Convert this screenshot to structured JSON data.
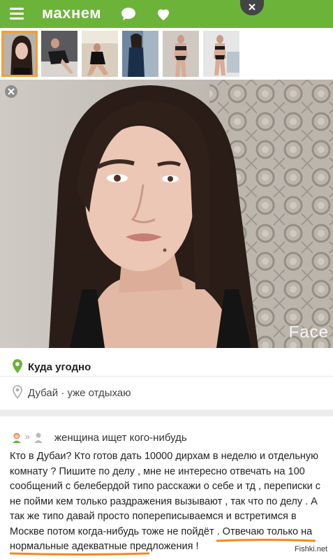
{
  "app": {
    "brand": "махнем",
    "colors": {
      "accent": "#6cb33a",
      "highlight": "#f0a030",
      "underline": "#f08a1e"
    }
  },
  "topbar": {
    "icons": [
      "menu-icon",
      "chat-bubble-icon",
      "heart-icon",
      "close-icon"
    ]
  },
  "gallery": {
    "thumbnail_count": 6,
    "selected_index": 0
  },
  "photo": {
    "watermark": "Face"
  },
  "locations": {
    "primary": "Куда угодно",
    "secondary": "Дубай · уже отдыхаю"
  },
  "profile": {
    "seeks": "женщина ищет кого-нибудь"
  },
  "post": {
    "text": "Кто в Дубаи? Кто готов дать 10000 дирхам в неделю и отдельную комнату ? Пишите по делу , мне не интересно отвечать на 100 сообщений с белебердой типо расскажи о себе и тд , переписки с не пойми кем только раздражения вызывают , так что по делу . А так же типо давай просто попереписываемся и встретимся в Москве потом когда-нибудь тоже не пойдёт . Отвечаю только на нормальные адекватные предложения !"
  },
  "source_watermark": "Fishki.net"
}
